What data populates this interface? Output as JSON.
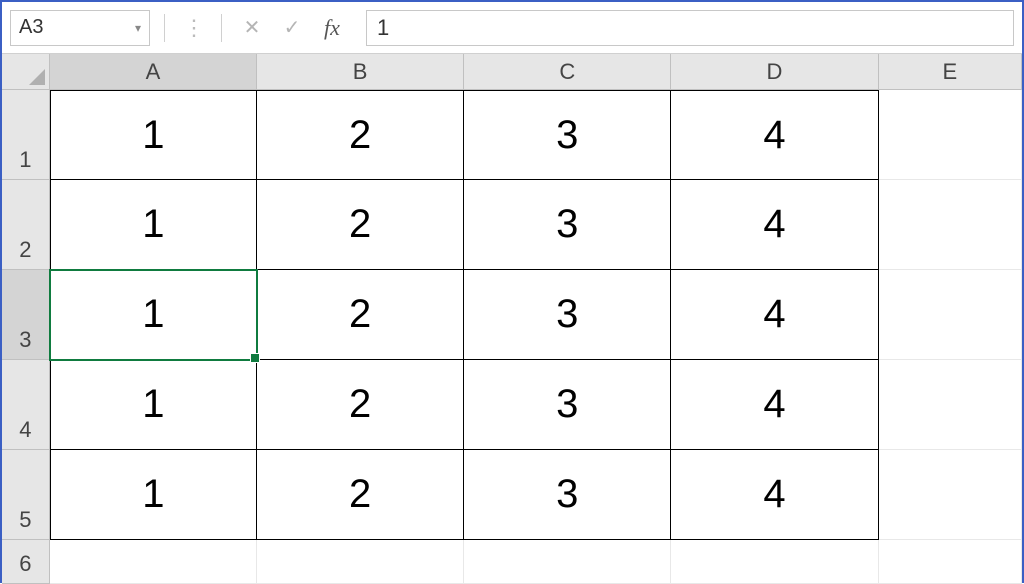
{
  "header": {
    "name_box": "A3",
    "cancel_icon": "✕",
    "enter_icon": "✓",
    "fx_label": "fx",
    "formula_value": "1"
  },
  "columns": [
    "A",
    "B",
    "C",
    "D",
    "E"
  ],
  "rows": [
    "1",
    "2",
    "3",
    "4",
    "5",
    "6"
  ],
  "active_cell": {
    "col": "A",
    "row": "3"
  },
  "data": {
    "r1": {
      "A": "1",
      "B": "2",
      "C": "3",
      "D": "4"
    },
    "r2": {
      "A": "1",
      "B": "2",
      "C": "3",
      "D": "4"
    },
    "r3": {
      "A": "1",
      "B": "2",
      "C": "3",
      "D": "4"
    },
    "r4": {
      "A": "1",
      "B": "2",
      "C": "3",
      "D": "4"
    },
    "r5": {
      "A": "1",
      "B": "2",
      "C": "3",
      "D": "4"
    }
  }
}
